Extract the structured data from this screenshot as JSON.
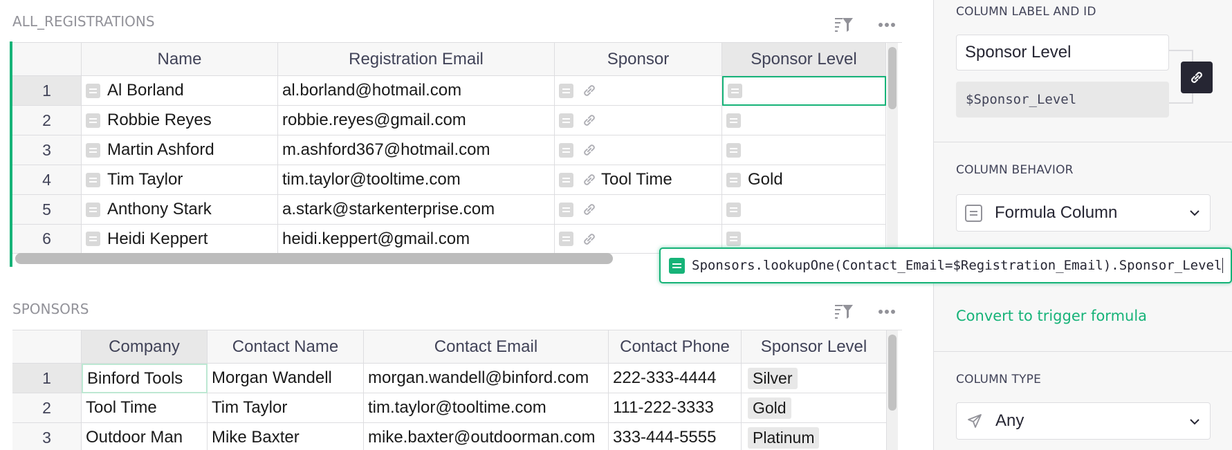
{
  "registrations": {
    "title": "ALL_REGISTRATIONS",
    "columns": [
      "Name",
      "Registration Email",
      "Sponsor",
      "Sponsor Level"
    ],
    "rows": [
      {
        "num": "1",
        "name": "Al Borland",
        "email": "al.borland@hotmail.com",
        "sponsor": "",
        "level": ""
      },
      {
        "num": "2",
        "name": "Robbie Reyes",
        "email": "robbie.reyes@gmail.com",
        "sponsor": "",
        "level": ""
      },
      {
        "num": "3",
        "name": "Martin Ashford",
        "email": "m.ashford367@hotmail.com",
        "sponsor": "",
        "level": ""
      },
      {
        "num": "4",
        "name": "Tim Taylor",
        "email": "tim.taylor@tooltime.com",
        "sponsor": "Tool Time",
        "level": "Gold"
      },
      {
        "num": "5",
        "name": "Anthony Stark",
        "email": "a.stark@starkenterprise.com",
        "sponsor": "",
        "level": ""
      },
      {
        "num": "6",
        "name": "Heidi Keppert",
        "email": "heidi.keppert@gmail.com",
        "sponsor": "",
        "level": ""
      }
    ]
  },
  "sponsors": {
    "title": "SPONSORS",
    "columns": [
      "Company",
      "Contact Name",
      "Contact Email",
      "Contact Phone",
      "Sponsor Level"
    ],
    "rows": [
      {
        "num": "1",
        "company": "Binford Tools",
        "contact": "Morgan Wandell",
        "email": "morgan.wandell@binford.com",
        "phone": "222-333-4444",
        "level": "Silver"
      },
      {
        "num": "2",
        "company": "Tool Time",
        "contact": "Tim Taylor",
        "email": "tim.taylor@tooltime.com",
        "phone": "111-222-3333",
        "level": "Gold"
      },
      {
        "num": "3",
        "company": "Outdoor Man",
        "contact": "Mike Baxter",
        "email": "mike.baxter@outdoorman.com",
        "phone": "333-444-5555",
        "level": "Platinum"
      }
    ]
  },
  "formula": {
    "text": "Sponsors.lookupOne(Contact_Email=$Registration_Email).Sponsor_Level"
  },
  "panel": {
    "label_heading": "COLUMN LABEL AND ID",
    "label_value": "Sponsor Level",
    "col_id": "$Sponsor_Level",
    "behavior_heading": "COLUMN BEHAVIOR",
    "behavior_value": "Formula Column",
    "convert_link": "Convert to trigger formula",
    "type_heading": "COLUMN TYPE",
    "type_value": "Any"
  },
  "colors": {
    "accent": "#16b378",
    "link_button": "#262633",
    "header_bg": "#f7f7f7",
    "border": "#dddde0"
  },
  "icons": [
    "sort-filter-icon",
    "more-options-icon",
    "formula-icon",
    "reference-link-icon",
    "chevron-down-icon",
    "send-icon"
  ]
}
